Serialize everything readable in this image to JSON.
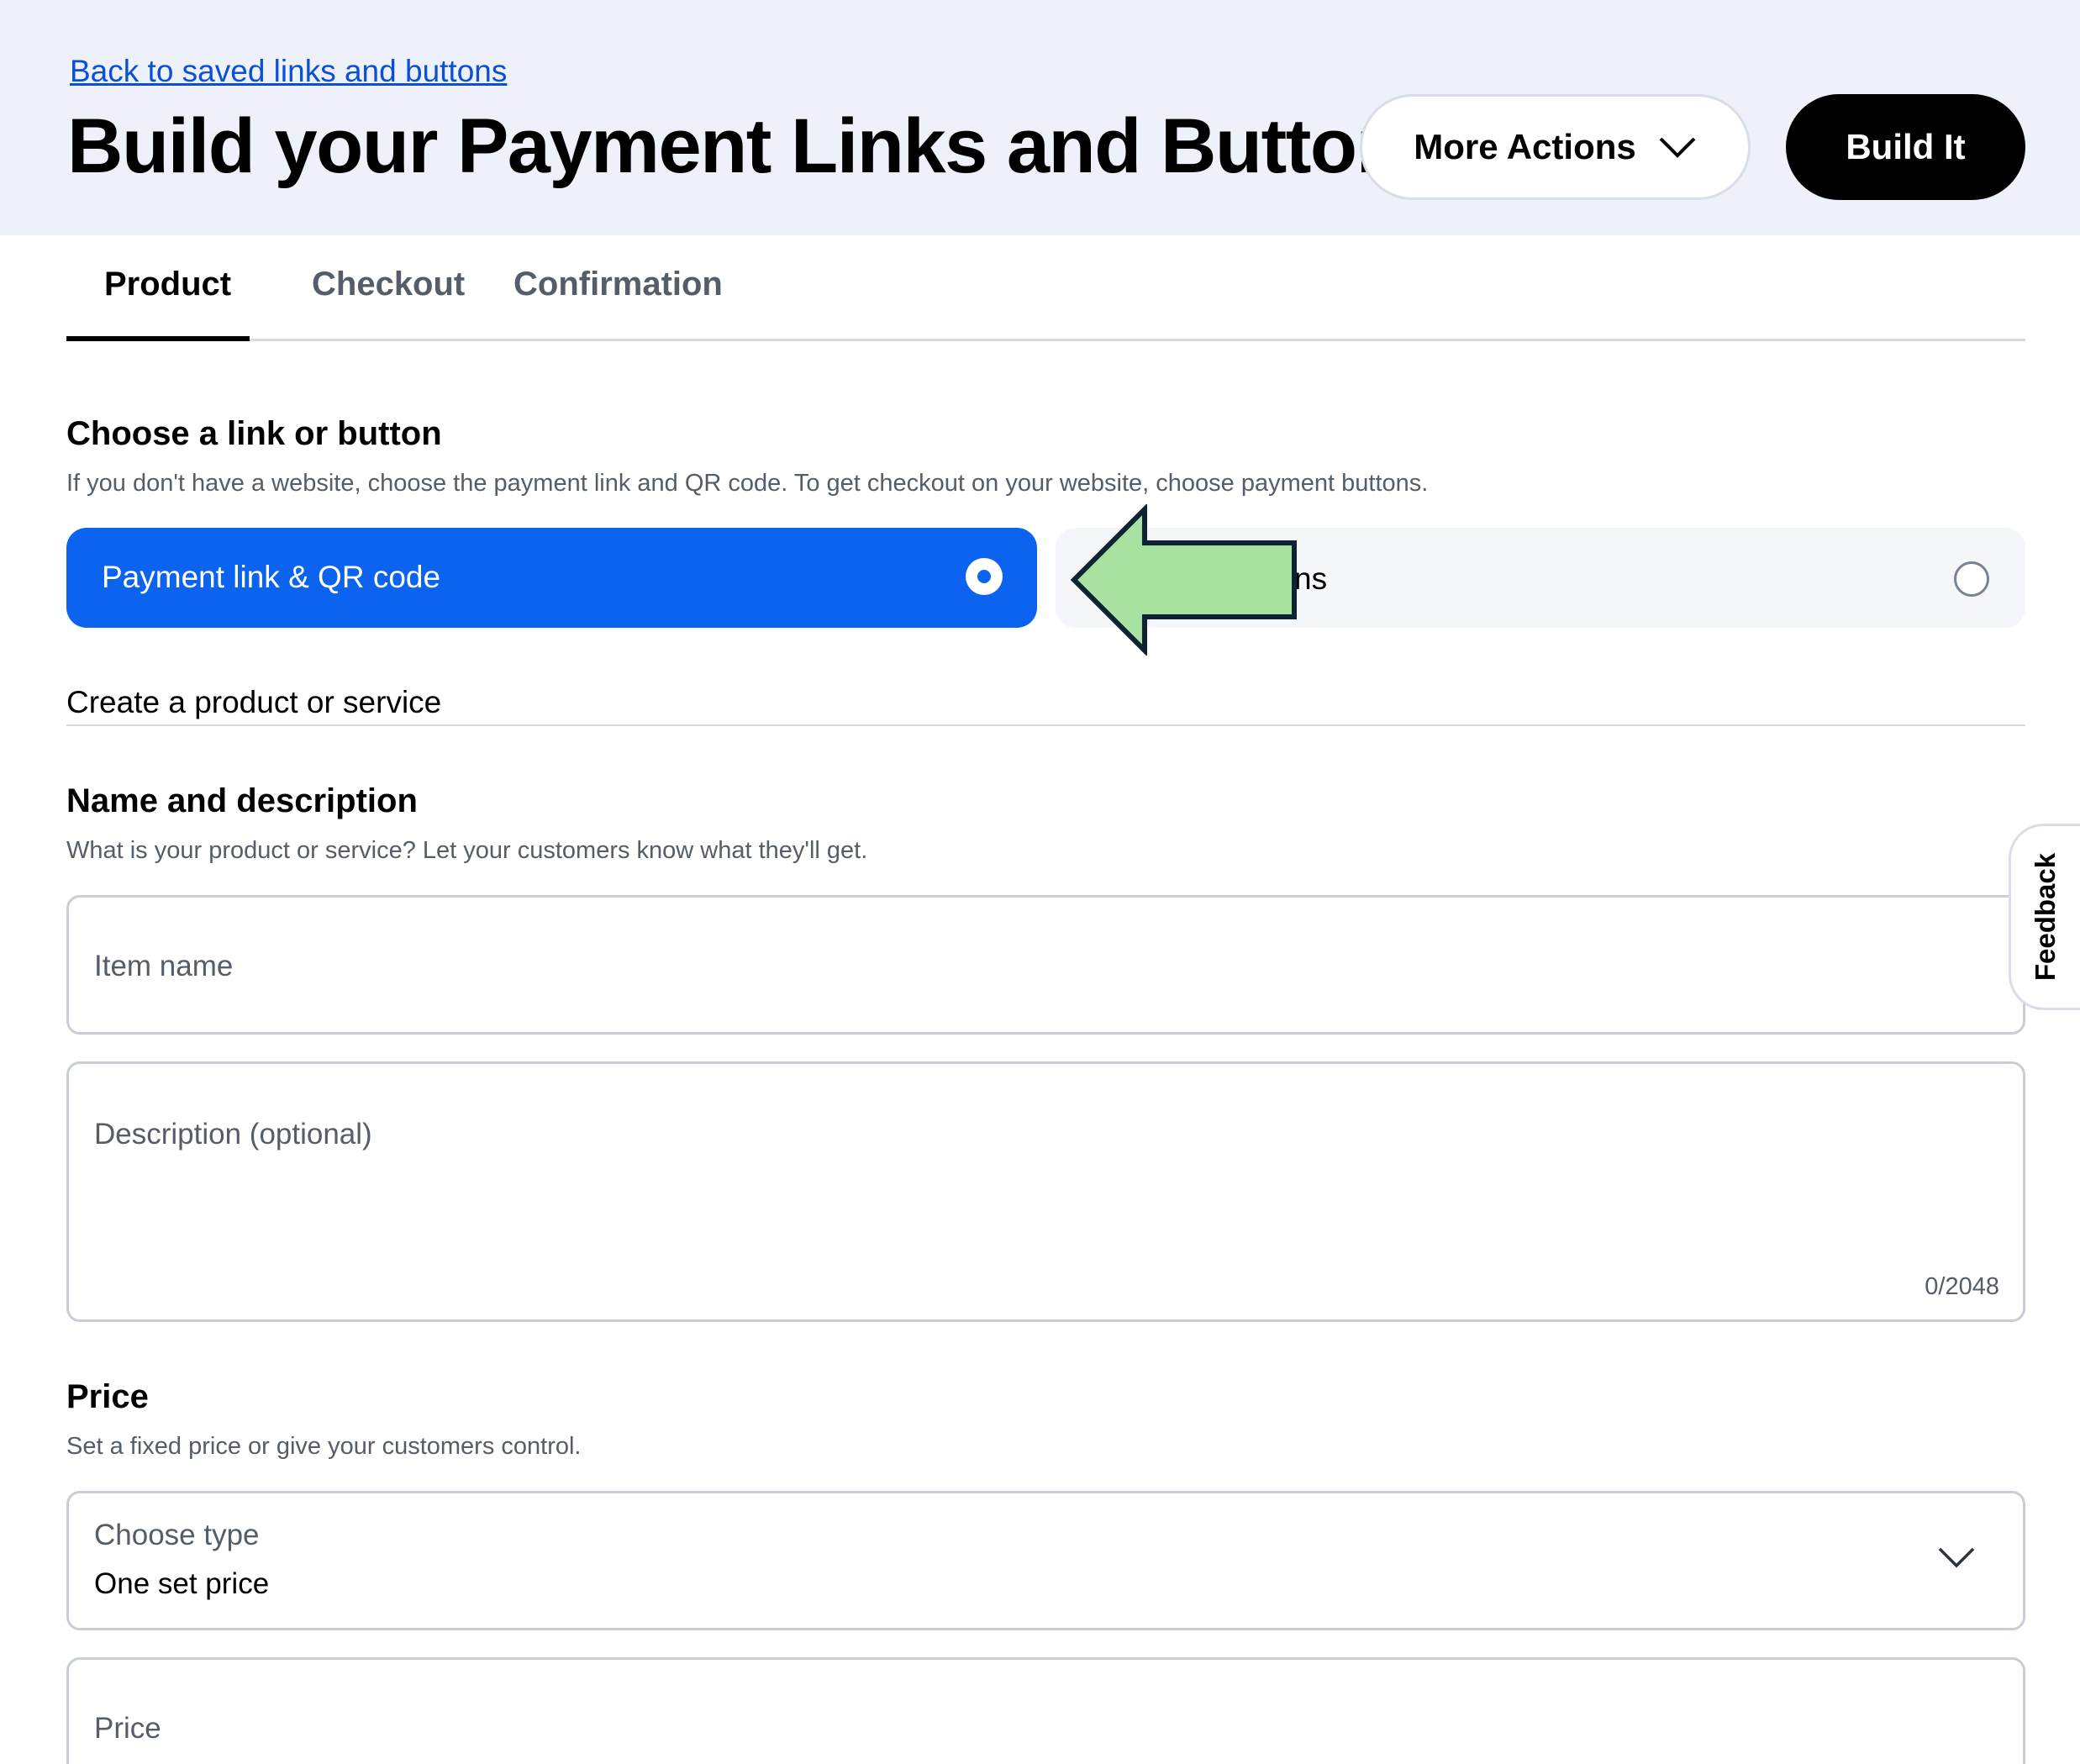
{
  "header": {
    "back_link": "Back to saved links and buttons",
    "title": "Build your Payment Links and Buttons",
    "more_actions": "More Actions",
    "build_it": "Build It"
  },
  "tabs": [
    {
      "label": "Product",
      "active": true
    },
    {
      "label": "Checkout",
      "active": false
    },
    {
      "label": "Confirmation",
      "active": false
    }
  ],
  "choose": {
    "heading": "Choose a link or button",
    "subtitle": "If you don't have a website, choose the payment link and QR code. To get checkout on your website, choose payment buttons.",
    "option_link": {
      "label": "Payment link & QR code",
      "selected": true
    },
    "option_buttons": {
      "label_visible": "ns",
      "selected": false
    }
  },
  "create_label": "Create a product or service",
  "name_desc": {
    "heading": "Name and description",
    "subtitle": "What is your product or service? Let your customers know what they'll get.",
    "item_name_placeholder": "Item name",
    "description_placeholder": "Description (optional)",
    "description_counter": "0/2048"
  },
  "price": {
    "heading": "Price",
    "subtitle": "Set a fixed price or give your customers control.",
    "type_label": "Choose type",
    "type_value": "One set price",
    "price_placeholder": "Price"
  },
  "feedback": {
    "label": "Feedback"
  },
  "colors": {
    "primary_blue": "#0b63f0",
    "link_blue": "#0a4fd6",
    "header_bg": "#eef1f9",
    "annotation_arrow": "#a8e2a0"
  },
  "icons": {
    "more_actions_chevron": "chevron-down-icon",
    "select_chevron": "chevron-down-icon",
    "annotation": "arrow-left-icon"
  }
}
